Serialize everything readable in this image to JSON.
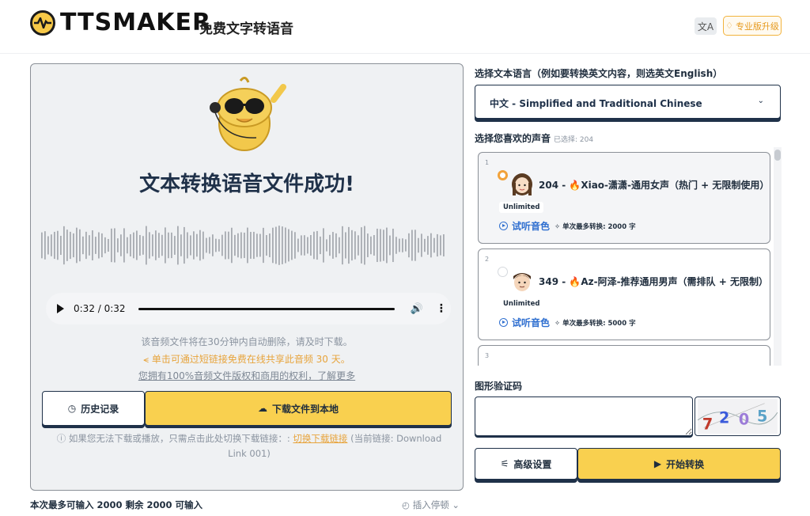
{
  "header": {
    "logo_text": "TTSMAKER",
    "subtitle": "免费文字转语音",
    "lang_switch_icon": "translate-icon",
    "pro_label": "专业版升级",
    "pro_icon": "diamond-icon"
  },
  "result": {
    "title": "文本转换语音文件成功!",
    "audio": {
      "time": "0:32 / 0:32"
    },
    "notice_delete": "该音频文件将在30分钟内自动删除，请及时下载。",
    "notice_share": "单击可通过短链接免费在线共享此音频 30 天。",
    "notice_rights": "您拥有100%音频文件版权和商用的权利，了解更多",
    "history_label": "历史记录",
    "download_label": "下载文件到本地",
    "switch_note_prefix": "如果您无法下载或播放，只需点击此处切换下载链接：:",
    "switch_link": "切换下载链接",
    "switch_note_suffix": "(当前链接: Download Link 001)"
  },
  "editor": {
    "input_count": "本次最多可输入 2000 剩余 2000 可输入",
    "insert_pause": "插入停顿"
  },
  "language": {
    "label": "选择文本语言（例如要转换英文内容，则选英文English）",
    "selected": "中文 - Simplified and Traditional Chinese"
  },
  "voices": {
    "label": "选择您喜欢的声音",
    "selected_hint": "已选择: 204",
    "items": [
      {
        "index": "1",
        "name": "204 - 🔥Xiao-潇潇-通用女声（热门 + 无限制使用）",
        "badge": "Unlimited",
        "listen": "试听音色",
        "max": "单次最多转换: 2000 字",
        "selected": true
      },
      {
        "index": "2",
        "name": "349 - 🔥Az-阿泽-推荐通用男声（需排队 + 无限制）",
        "badge": "Unlimited",
        "listen": "试听音色",
        "max": "单次最多转换: 5000 字",
        "selected": false
      },
      {
        "index": "3"
      }
    ]
  },
  "captcha": {
    "label": "图形验证码",
    "code": "7205"
  },
  "actions": {
    "advanced_label": "高级设置",
    "start_label": "开始转换"
  },
  "colors": {
    "accent": "#f9d04f",
    "navy": "#1f3149",
    "link_blue": "#2f6fd0",
    "orange": "#e7a43c"
  }
}
